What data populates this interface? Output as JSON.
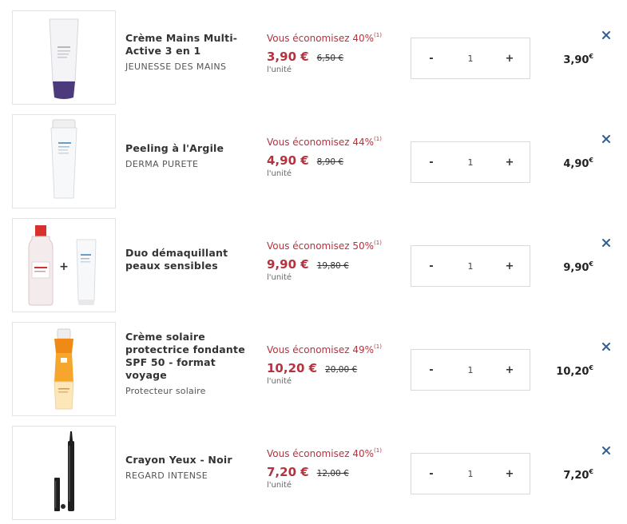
{
  "cart": {
    "items": [
      {
        "name": "Crème Mains Multi-Active 3 en 1",
        "line": "JEUNESSE DES MAINS",
        "savings": "Vous économisez 40%",
        "note": "(1)",
        "price": "3,90 €",
        "old_price": "6,50 €",
        "unit": "l'unité",
        "minus": "-",
        "quantity": "1",
        "plus": "+",
        "total": "3,90",
        "total_currency": "€",
        "image_icon": "hand-cream-tube-icon"
      },
      {
        "name": "Peeling à l'Argile",
        "line": "DERMA PURETE",
        "savings": "Vous économisez 44%",
        "note": "(1)",
        "price": "4,90 €",
        "old_price": "8,90 €",
        "unit": "l'unité",
        "minus": "-",
        "quantity": "1",
        "plus": "+",
        "total": "4,90",
        "total_currency": "€",
        "image_icon": "peeling-tube-icon"
      },
      {
        "name": "Duo démaquillant peaux sensibles",
        "line": "",
        "savings": "Vous économisez 50%",
        "note": "(1)",
        "price": "9,90 €",
        "old_price": "19,80 €",
        "unit": "l'unité",
        "minus": "-",
        "quantity": "1",
        "plus": "+",
        "total": "9,90",
        "total_currency": "€",
        "image_icon": "micellar-duo-icon"
      },
      {
        "name": "Crème solaire protectrice fondante SPF 50 - format voyage",
        "line": "Protecteur solaire",
        "savings": "Vous économisez 49%",
        "note": "(1)",
        "price": "10,20 €",
        "old_price": "20,00 €",
        "unit": "l'unité",
        "minus": "-",
        "quantity": "1",
        "plus": "+",
        "total": "10,20",
        "total_currency": "€",
        "image_icon": "sunscreen-tube-icon"
      },
      {
        "name": "Crayon Yeux - Noir",
        "line": "REGARD INTENSE",
        "savings": "Vous économisez 40%",
        "note": "(1)",
        "price": "7,20 €",
        "old_price": "12,00 €",
        "unit": "l'unité",
        "minus": "-",
        "quantity": "1",
        "plus": "+",
        "total": "7,20",
        "total_currency": "€",
        "image_icon": "eye-pencil-icon"
      }
    ]
  },
  "colors": {
    "accent": "#b5323f",
    "remove_icon": "#2f5f8f",
    "border": "#e3e3e3"
  }
}
